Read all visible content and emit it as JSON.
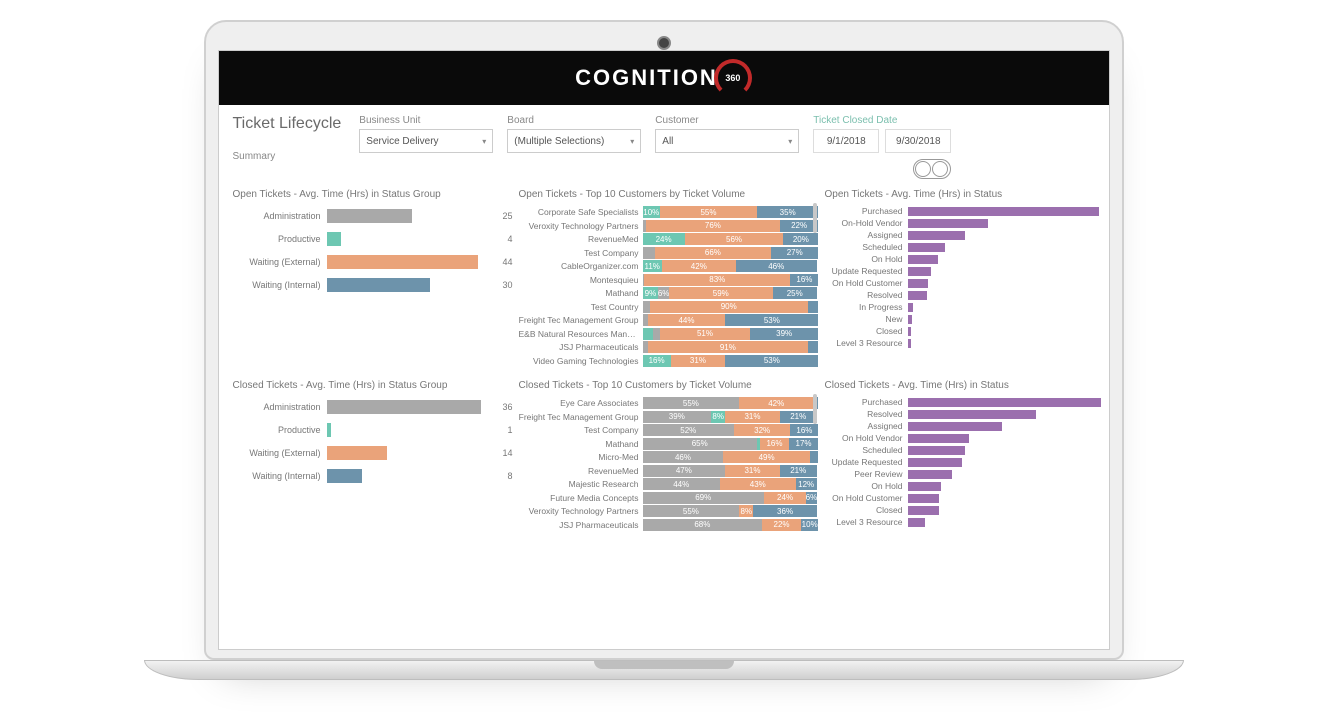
{
  "brand": {
    "name": "COGNITION",
    "badge": "360"
  },
  "page": {
    "title": "Ticket Lifecycle",
    "subtitle": "Summary"
  },
  "filters": {
    "business_unit": {
      "label": "Business Unit",
      "value": "Service Delivery"
    },
    "board": {
      "label": "Board",
      "value": "(Multiple Selections)"
    },
    "customer": {
      "label": "Customer",
      "value": "All"
    },
    "date": {
      "label": "Ticket Closed Date",
      "from": "9/1/2018",
      "to": "9/30/2018"
    }
  },
  "colors": {
    "gray": "#a9a9a9",
    "teal": "#6dc7b2",
    "orange": "#eaa37a",
    "blue": "#6d93ab",
    "purple": "#9b6fae"
  },
  "chart_data": [
    {
      "id": "open_status_group",
      "type": "bar",
      "title": "Open Tickets - Avg. Time (Hrs) in Status Group",
      "categories": [
        "Administration",
        "Productive",
        "Waiting (External)",
        "Waiting (Internal)"
      ],
      "values": [
        25,
        4,
        44,
        30
      ],
      "series_colors": [
        "gray",
        "teal",
        "orange",
        "blue"
      ],
      "xlim": [
        0,
        50
      ]
    },
    {
      "id": "closed_status_group",
      "type": "bar",
      "title": "Closed Tickets - Avg. Time (Hrs) in Status Group",
      "categories": [
        "Administration",
        "Productive",
        "Waiting (External)",
        "Waiting (Internal)"
      ],
      "values": [
        36,
        1,
        14,
        8
      ],
      "series_colors": [
        "gray",
        "teal",
        "orange",
        "blue"
      ],
      "xlim": [
        0,
        40
      ]
    },
    {
      "id": "open_customers",
      "type": "bar",
      "title": "Open Tickets - Top 10 Customers by Ticket Volume",
      "stacked": true,
      "segment_colors": [
        "teal",
        "gray",
        "orange",
        "blue"
      ],
      "rows": [
        {
          "label": "Corporate Safe Specialists",
          "segments": [
            {
              "pct": 10,
              "text": "10%"
            },
            {
              "pct": 0,
              "text": ""
            },
            {
              "pct": 55,
              "text": "55%"
            },
            {
              "pct": 35,
              "text": "35%"
            }
          ]
        },
        {
          "label": "Veroxity Technology Partners",
          "segments": [
            {
              "pct": 0,
              "text": ""
            },
            {
              "pct": 2,
              "text": ""
            },
            {
              "pct": 76,
              "text": "76%"
            },
            {
              "pct": 22,
              "text": "22%"
            }
          ]
        },
        {
          "label": "RevenueMed",
          "segments": [
            {
              "pct": 24,
              "text": "24%"
            },
            {
              "pct": 0,
              "text": ""
            },
            {
              "pct": 56,
              "text": "56%"
            },
            {
              "pct": 20,
              "text": "20%"
            }
          ]
        },
        {
          "label": "Test Company",
          "segments": [
            {
              "pct": 0,
              "text": ""
            },
            {
              "pct": 7,
              "text": ""
            },
            {
              "pct": 66,
              "text": "66%"
            },
            {
              "pct": 27,
              "text": "27%"
            }
          ]
        },
        {
          "label": "CableOrganizer.com",
          "segments": [
            {
              "pct": 11,
              "text": "11%"
            },
            {
              "pct": 0,
              "text": ""
            },
            {
              "pct": 42,
              "text": "42%"
            },
            {
              "pct": 46,
              "text": "46%"
            }
          ]
        },
        {
          "label": "Montesquieu",
          "segments": [
            {
              "pct": 0,
              "text": ""
            },
            {
              "pct": 1,
              "text": ""
            },
            {
              "pct": 83,
              "text": "83%"
            },
            {
              "pct": 16,
              "text": "16%"
            }
          ]
        },
        {
          "label": "Mathand",
          "segments": [
            {
              "pct": 9,
              "text": "9%"
            },
            {
              "pct": 6,
              "text": "6%"
            },
            {
              "pct": 59,
              "text": "59%"
            },
            {
              "pct": 25,
              "text": "25%"
            }
          ]
        },
        {
          "label": "Test Country",
          "segments": [
            {
              "pct": 0,
              "text": ""
            },
            {
              "pct": 4,
              "text": ""
            },
            {
              "pct": 90,
              "text": "90%"
            },
            {
              "pct": 6,
              "text": ""
            }
          ]
        },
        {
          "label": "Freight Tec Management Group",
          "segments": [
            {
              "pct": 0,
              "text": ""
            },
            {
              "pct": 3,
              "text": ""
            },
            {
              "pct": 44,
              "text": "44%"
            },
            {
              "pct": 53,
              "text": "53%"
            }
          ]
        },
        {
          "label": "E&B Natural Resources Management",
          "segments": [
            {
              "pct": 6,
              "text": ""
            },
            {
              "pct": 4,
              "text": ""
            },
            {
              "pct": 51,
              "text": "51%"
            },
            {
              "pct": 39,
              "text": "39%"
            }
          ]
        },
        {
          "label": "JSJ Pharmaceuticals",
          "segments": [
            {
              "pct": 0,
              "text": ""
            },
            {
              "pct": 3,
              "text": ""
            },
            {
              "pct": 91,
              "text": "91%"
            },
            {
              "pct": 6,
              "text": ""
            }
          ]
        },
        {
          "label": "Video Gaming Technologies",
          "segments": [
            {
              "pct": 16,
              "text": "16%"
            },
            {
              "pct": 0,
              "text": ""
            },
            {
              "pct": 31,
              "text": "31%"
            },
            {
              "pct": 53,
              "text": "53%"
            }
          ]
        }
      ]
    },
    {
      "id": "closed_customers",
      "type": "bar",
      "title": "Closed Tickets - Top 10 Customers by Ticket Volume",
      "stacked": true,
      "segment_colors": [
        "gray",
        "teal",
        "orange",
        "blue"
      ],
      "rows": [
        {
          "label": "Eye Care Associates",
          "segments": [
            {
              "pct": 55,
              "text": "55%"
            },
            {
              "pct": 0,
              "text": ""
            },
            {
              "pct": 42,
              "text": "42%"
            },
            {
              "pct": 3,
              "text": ""
            }
          ]
        },
        {
          "label": "Freight Tec Management Group",
          "segments": [
            {
              "pct": 39,
              "text": "39%"
            },
            {
              "pct": 8,
              "text": "8%"
            },
            {
              "pct": 31,
              "text": "31%"
            },
            {
              "pct": 21,
              "text": "21%"
            }
          ]
        },
        {
          "label": "Test Company",
          "segments": [
            {
              "pct": 52,
              "text": "52%"
            },
            {
              "pct": 0,
              "text": ""
            },
            {
              "pct": 32,
              "text": "32%"
            },
            {
              "pct": 16,
              "text": "16%"
            }
          ]
        },
        {
          "label": "Mathand",
          "segments": [
            {
              "pct": 65,
              "text": "65%"
            },
            {
              "pct": 2,
              "text": ""
            },
            {
              "pct": 16,
              "text": "16%"
            },
            {
              "pct": 17,
              "text": "17%"
            }
          ]
        },
        {
          "label": "Micro-Med",
          "segments": [
            {
              "pct": 46,
              "text": "46%"
            },
            {
              "pct": 0,
              "text": ""
            },
            {
              "pct": 49,
              "text": "49%"
            },
            {
              "pct": 5,
              "text": ""
            }
          ]
        },
        {
          "label": "RevenueMed",
          "segments": [
            {
              "pct": 47,
              "text": "47%"
            },
            {
              "pct": 0,
              "text": ""
            },
            {
              "pct": 31,
              "text": "31%"
            },
            {
              "pct": 21,
              "text": "21%"
            }
          ]
        },
        {
          "label": "Majestic Research",
          "segments": [
            {
              "pct": 44,
              "text": "44%"
            },
            {
              "pct": 0,
              "text": ""
            },
            {
              "pct": 43,
              "text": "43%"
            },
            {
              "pct": 12,
              "text": "12%"
            }
          ]
        },
        {
          "label": "Future Media Concepts",
          "segments": [
            {
              "pct": 69,
              "text": "69%"
            },
            {
              "pct": 0,
              "text": ""
            },
            {
              "pct": 24,
              "text": "24%"
            },
            {
              "pct": 6,
              "text": "6%"
            }
          ]
        },
        {
          "label": "Veroxity Technology Partners",
          "segments": [
            {
              "pct": 55,
              "text": "55%"
            },
            {
              "pct": 0,
              "text": ""
            },
            {
              "pct": 8,
              "text": "8%"
            },
            {
              "pct": 36,
              "text": "36%"
            }
          ]
        },
        {
          "label": "JSJ Pharmaceuticals",
          "segments": [
            {
              "pct": 68,
              "text": "68%"
            },
            {
              "pct": 0,
              "text": ""
            },
            {
              "pct": 22,
              "text": "22%"
            },
            {
              "pct": 10,
              "text": "10%"
            }
          ]
        }
      ]
    },
    {
      "id": "open_status",
      "type": "bar",
      "title": "Open Tickets - Avg. Time (Hrs) in Status",
      "categories": [
        "Purchased",
        "On-Hold Vendor",
        "Assigned",
        "Scheduled",
        "On Hold",
        "Update Requested",
        "On Hold Customer",
        "Resolved",
        "In Progress",
        "New",
        "Closed",
        "Level 3 Resource"
      ],
      "values": [
        222,
        91,
        65,
        42,
        34,
        26,
        23,
        22,
        6,
        5,
        4,
        4
      ],
      "xlim": [
        0,
        230
      ]
    },
    {
      "id": "closed_status",
      "type": "bar",
      "title": "Closed Tickets - Avg. Time (Hrs) in Status",
      "categories": [
        "Purchased",
        "Resolved",
        "Assigned",
        "On Hold Vendor",
        "Scheduled",
        "Update Requested",
        "Peer Review",
        "On Hold",
        "On Hold Customer",
        "Closed",
        "Level 3 Resource"
      ],
      "values": [
        57,
        38,
        28,
        18,
        17,
        16,
        13,
        10,
        9,
        9,
        5
      ],
      "xlim": [
        0,
        60
      ]
    }
  ]
}
